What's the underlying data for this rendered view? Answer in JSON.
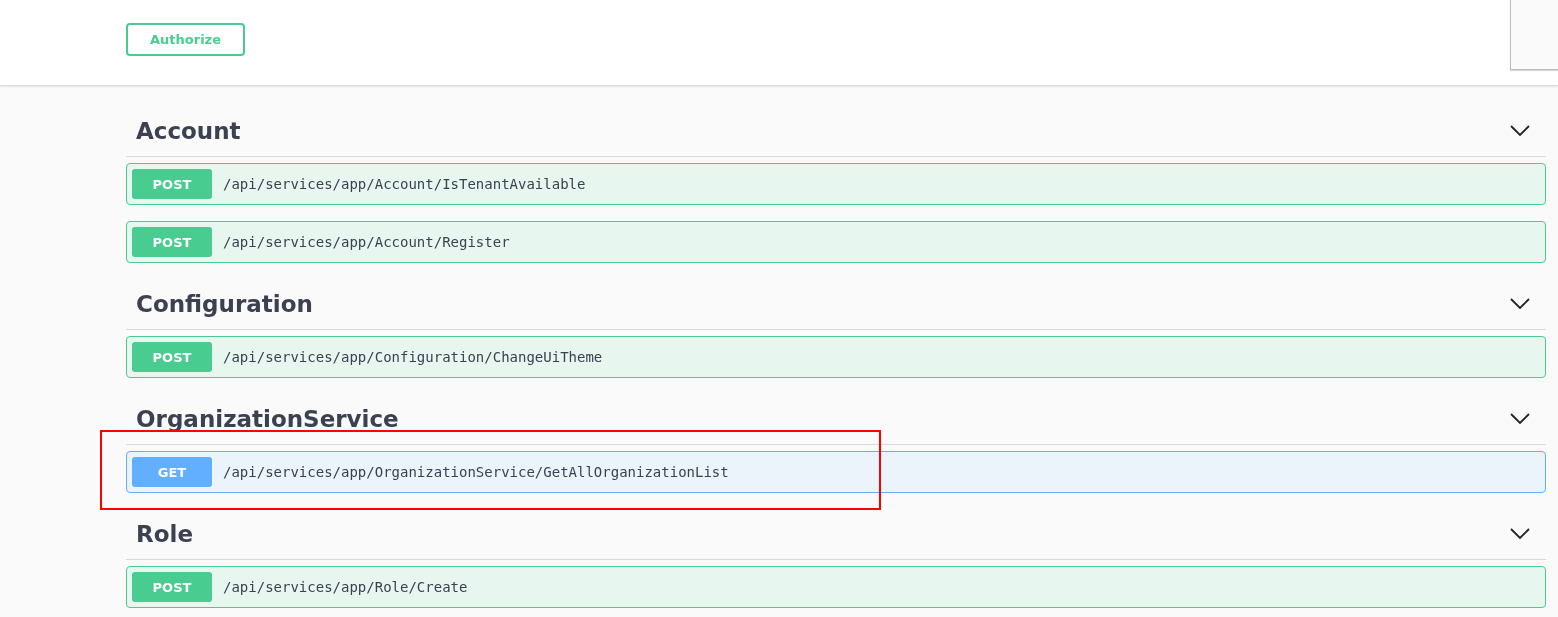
{
  "header": {
    "authorize_button": "Authorize"
  },
  "sections": [
    {
      "name": "Account",
      "expanded": true,
      "operations": [
        {
          "method": "POST",
          "path": "/api/services/app/Account/IsTenantAvailable",
          "highlighted": false
        },
        {
          "method": "POST",
          "path": "/api/services/app/Account/Register",
          "highlighted": false
        }
      ]
    },
    {
      "name": "Configuration",
      "expanded": true,
      "operations": [
        {
          "method": "POST",
          "path": "/api/services/app/Configuration/ChangeUiTheme",
          "highlighted": false
        }
      ]
    },
    {
      "name": "OrganizationService",
      "expanded": true,
      "operations": [
        {
          "method": "GET",
          "path": "/api/services/app/OrganizationService/GetAllOrganizationList",
          "highlighted": true
        }
      ]
    },
    {
      "name": "Role",
      "expanded": true,
      "operations": [
        {
          "method": "POST",
          "path": "/api/services/app/Role/Create",
          "highlighted": false
        }
      ]
    }
  ]
}
